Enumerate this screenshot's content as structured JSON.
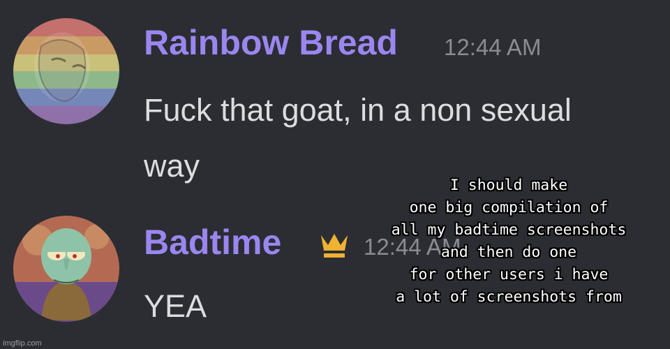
{
  "messages": [
    {
      "username": "Rainbow Bread",
      "timestamp": "12:44 AM",
      "lines": [
        "Fuck that goat, in a non sexual",
        "way"
      ],
      "avatar": "rainbow-flag-avatar",
      "name_color": "#9b86f0"
    },
    {
      "username": "Badtime",
      "timestamp": "12:44 AM",
      "lines": [
        "YEA"
      ],
      "badge": "crown-icon",
      "avatar": "squidward-avatar",
      "name_color": "#9b86f0"
    }
  ],
  "caption": {
    "lines": [
      "I should make",
      "one big compilation of",
      "all my badtime screenshots",
      "and then do one",
      "for other users i have",
      "a lot of screenshots from"
    ]
  },
  "watermark": "imgflip.com",
  "colors": {
    "background": "#2b2d33",
    "username": "#9b86f0",
    "timestamp": "#8a8c92",
    "text": "#dcdde1",
    "crown": "#f0b232"
  }
}
